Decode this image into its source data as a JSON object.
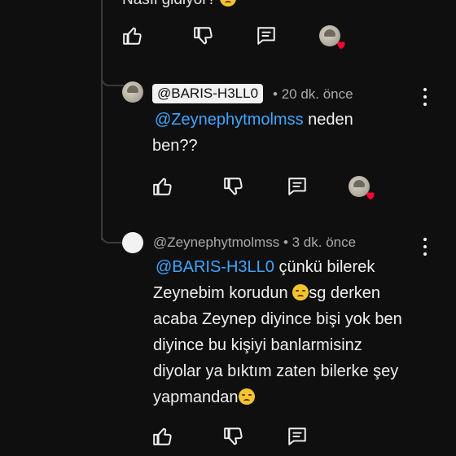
{
  "previous_comment": {
    "cut_text": "Nasıl gidiyor?"
  },
  "reply_1": {
    "author": "@BARIS-H3LL0",
    "separator": "•",
    "time": "20 dk. önce",
    "mention": "@Zeynephytmolmss",
    "text_after_mention": " neden",
    "text_line2": "ben??"
  },
  "reply_2": {
    "author": "@Zeynephytmolmss",
    "separator": "•",
    "time": "3 dk. önce",
    "mention": "@BARIS-H3LL0",
    "line1_rest": " çünkü bilerek",
    "line2": "Zeynebim korudun ",
    "line2_after_emoji": "sg derken",
    "line3": "acaba Zeynep diyince bişi yok ben",
    "line4": "diyince bu kişiyi banlarmisinz",
    "line5": "diyolar ya bıktım zaten bilerke şey",
    "line6": "yapmandan"
  },
  "icons": {
    "like": "thumbs-up-icon",
    "dislike": "thumbs-down-icon",
    "reply": "reply-comment-icon",
    "creator_heart": "creator-heart-icon",
    "more": "more-vert-icon"
  },
  "colors": {
    "background": "#0f0f0f",
    "mention": "#3ea6ff",
    "heart": "#ff0033",
    "meta": "#aaaaaa"
  }
}
